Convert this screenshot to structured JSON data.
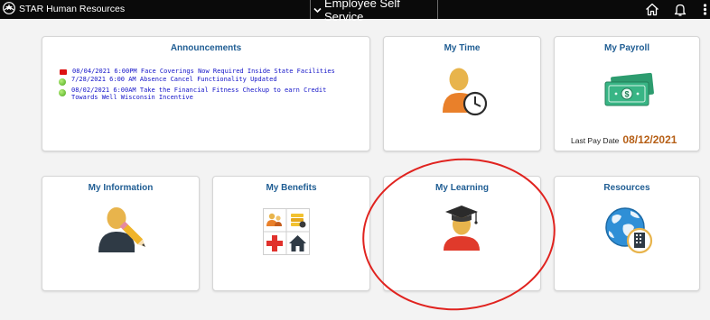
{
  "header": {
    "app_title": "STAR Human Resources",
    "homepage_selector": "Employee Self Service",
    "icons": {
      "logo": "star-logo-icon",
      "dropdown": "chevron-down-icon",
      "home": "home-icon",
      "notifications": "bell-icon",
      "actions": "vertical-dots-icon"
    },
    "background_color": "#0a0a0a"
  },
  "tiles": {
    "announcements": {
      "title": "Announcements",
      "items": [
        {
          "bullet": "red",
          "text": "08/04/2021 6:00PM Face Coverings Now Required Inside State Facilities"
        },
        {
          "bullet": "green",
          "text": "7/28/2021 6:00 AM Absence Cancel Functionality Updated"
        },
        {
          "bullet": "green",
          "text": "08/02/2021 6:00AM Take the Financial Fitness Checkup to earn Credit Towards Well Wisconsin Incentive"
        }
      ]
    },
    "my_time": {
      "title": "My Time",
      "icon": "person-clock-icon"
    },
    "my_payroll": {
      "title": "My Payroll",
      "icon": "money-icon",
      "last_pay_label": "Last Pay Date",
      "last_pay_date": "08/12/2021"
    },
    "my_information": {
      "title": "My Information",
      "icon": "person-pencil-icon"
    },
    "my_benefits": {
      "title": "My Benefits",
      "icon": "benefits-grid-icon"
    },
    "my_learning": {
      "title": "My Learning",
      "icon": "graduate-icon"
    },
    "resources": {
      "title": "Resources",
      "icon": "globe-building-icon"
    }
  },
  "colors": {
    "tile_title": "#1f5d93",
    "link": "#1414c8",
    "pay_date": "#b65f16",
    "annotation_circle": "#e0231f"
  }
}
